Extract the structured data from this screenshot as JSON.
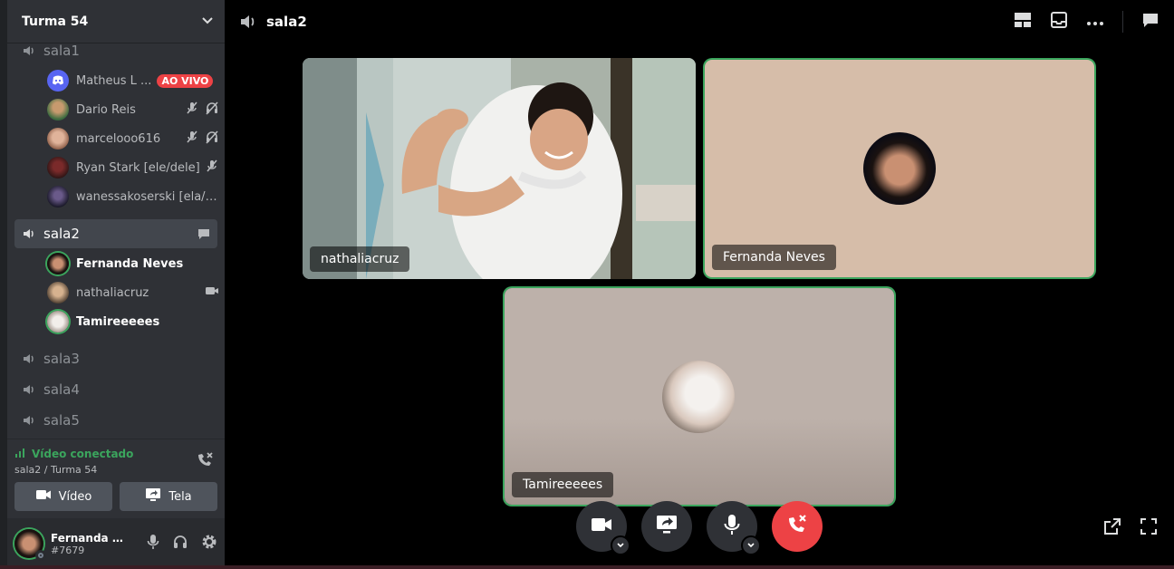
{
  "server": {
    "name": "Turma 54"
  },
  "channels": {
    "sala1": {
      "name": "sala1",
      "users": [
        {
          "name": "Matheus L ...",
          "badge": "AO VIVO"
        },
        {
          "name": "Dario Reis"
        },
        {
          "name": "marcelooo616"
        },
        {
          "name": "Ryan Stark [ele/dele]"
        },
        {
          "name": "wanessakoserski [ela/de..."
        }
      ]
    },
    "sala2": {
      "name": "sala2",
      "users": [
        {
          "name": "Fernanda Neves"
        },
        {
          "name": "nathaliacruz"
        },
        {
          "name": "Tamireeeees"
        }
      ]
    },
    "sala3": {
      "name": "sala3"
    },
    "sala4": {
      "name": "sala4"
    },
    "sala5": {
      "name": "sala5"
    }
  },
  "voice_panel": {
    "status": "Vídeo conectado",
    "location": "sala2 / Turma 54",
    "video_label": "Vídeo",
    "screen_label": "Tela"
  },
  "user_panel": {
    "name": "Fernanda N...",
    "tag": "#7679"
  },
  "main": {
    "channel_title": "sala2",
    "tiles": [
      {
        "name": "nathaliacruz"
      },
      {
        "name": "Fernanda Neves"
      },
      {
        "name": "Tamireeeees"
      }
    ]
  },
  "colors": {
    "accent_green": "#3ba55d",
    "danger_red": "#ed4245",
    "sidebar_bg": "#2f3136",
    "panel_bg": "#292b2f"
  }
}
